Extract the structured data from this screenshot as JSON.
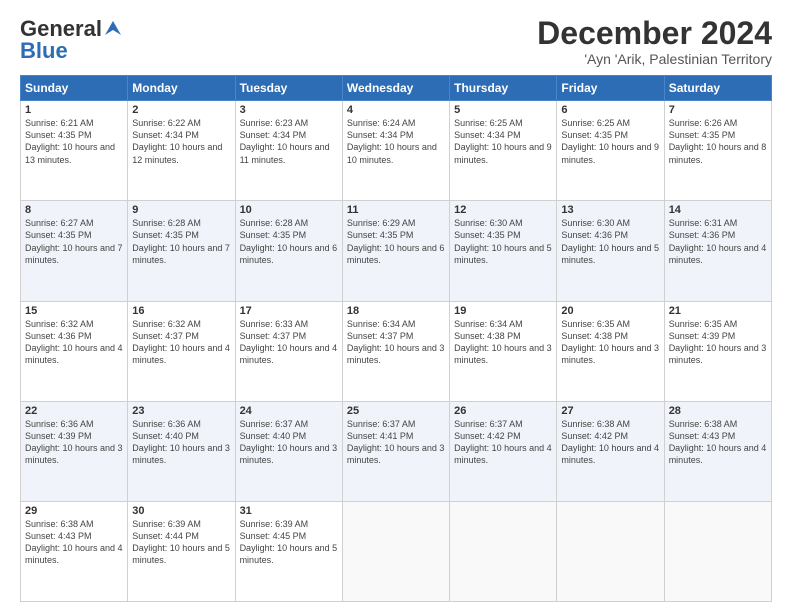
{
  "logo": {
    "general": "General",
    "blue": "Blue"
  },
  "header": {
    "month": "December 2024",
    "location": "'Ayn 'Arik, Palestinian Territory"
  },
  "days": [
    "Sunday",
    "Monday",
    "Tuesday",
    "Wednesday",
    "Thursday",
    "Friday",
    "Saturday"
  ],
  "cells": [
    [
      {
        "num": "1",
        "rise": "Sunrise: 6:21 AM",
        "set": "Sunset: 4:35 PM",
        "day": "Daylight: 10 hours and 13 minutes."
      },
      {
        "num": "2",
        "rise": "Sunrise: 6:22 AM",
        "set": "Sunset: 4:34 PM",
        "day": "Daylight: 10 hours and 12 minutes."
      },
      {
        "num": "3",
        "rise": "Sunrise: 6:23 AM",
        "set": "Sunset: 4:34 PM",
        "day": "Daylight: 10 hours and 11 minutes."
      },
      {
        "num": "4",
        "rise": "Sunrise: 6:24 AM",
        "set": "Sunset: 4:34 PM",
        "day": "Daylight: 10 hours and 10 minutes."
      },
      {
        "num": "5",
        "rise": "Sunrise: 6:25 AM",
        "set": "Sunset: 4:34 PM",
        "day": "Daylight: 10 hours and 9 minutes."
      },
      {
        "num": "6",
        "rise": "Sunrise: 6:25 AM",
        "set": "Sunset: 4:35 PM",
        "day": "Daylight: 10 hours and 9 minutes."
      },
      {
        "num": "7",
        "rise": "Sunrise: 6:26 AM",
        "set": "Sunset: 4:35 PM",
        "day": "Daylight: 10 hours and 8 minutes."
      }
    ],
    [
      {
        "num": "8",
        "rise": "Sunrise: 6:27 AM",
        "set": "Sunset: 4:35 PM",
        "day": "Daylight: 10 hours and 7 minutes."
      },
      {
        "num": "9",
        "rise": "Sunrise: 6:28 AM",
        "set": "Sunset: 4:35 PM",
        "day": "Daylight: 10 hours and 7 minutes."
      },
      {
        "num": "10",
        "rise": "Sunrise: 6:28 AM",
        "set": "Sunset: 4:35 PM",
        "day": "Daylight: 10 hours and 6 minutes."
      },
      {
        "num": "11",
        "rise": "Sunrise: 6:29 AM",
        "set": "Sunset: 4:35 PM",
        "day": "Daylight: 10 hours and 6 minutes."
      },
      {
        "num": "12",
        "rise": "Sunrise: 6:30 AM",
        "set": "Sunset: 4:35 PM",
        "day": "Daylight: 10 hours and 5 minutes."
      },
      {
        "num": "13",
        "rise": "Sunrise: 6:30 AM",
        "set": "Sunset: 4:36 PM",
        "day": "Daylight: 10 hours and 5 minutes."
      },
      {
        "num": "14",
        "rise": "Sunrise: 6:31 AM",
        "set": "Sunset: 4:36 PM",
        "day": "Daylight: 10 hours and 4 minutes."
      }
    ],
    [
      {
        "num": "15",
        "rise": "Sunrise: 6:32 AM",
        "set": "Sunset: 4:36 PM",
        "day": "Daylight: 10 hours and 4 minutes."
      },
      {
        "num": "16",
        "rise": "Sunrise: 6:32 AM",
        "set": "Sunset: 4:37 PM",
        "day": "Daylight: 10 hours and 4 minutes."
      },
      {
        "num": "17",
        "rise": "Sunrise: 6:33 AM",
        "set": "Sunset: 4:37 PM",
        "day": "Daylight: 10 hours and 4 minutes."
      },
      {
        "num": "18",
        "rise": "Sunrise: 6:34 AM",
        "set": "Sunset: 4:37 PM",
        "day": "Daylight: 10 hours and 3 minutes."
      },
      {
        "num": "19",
        "rise": "Sunrise: 6:34 AM",
        "set": "Sunset: 4:38 PM",
        "day": "Daylight: 10 hours and 3 minutes."
      },
      {
        "num": "20",
        "rise": "Sunrise: 6:35 AM",
        "set": "Sunset: 4:38 PM",
        "day": "Daylight: 10 hours and 3 minutes."
      },
      {
        "num": "21",
        "rise": "Sunrise: 6:35 AM",
        "set": "Sunset: 4:39 PM",
        "day": "Daylight: 10 hours and 3 minutes."
      }
    ],
    [
      {
        "num": "22",
        "rise": "Sunrise: 6:36 AM",
        "set": "Sunset: 4:39 PM",
        "day": "Daylight: 10 hours and 3 minutes."
      },
      {
        "num": "23",
        "rise": "Sunrise: 6:36 AM",
        "set": "Sunset: 4:40 PM",
        "day": "Daylight: 10 hours and 3 minutes."
      },
      {
        "num": "24",
        "rise": "Sunrise: 6:37 AM",
        "set": "Sunset: 4:40 PM",
        "day": "Daylight: 10 hours and 3 minutes."
      },
      {
        "num": "25",
        "rise": "Sunrise: 6:37 AM",
        "set": "Sunset: 4:41 PM",
        "day": "Daylight: 10 hours and 3 minutes."
      },
      {
        "num": "26",
        "rise": "Sunrise: 6:37 AM",
        "set": "Sunset: 4:42 PM",
        "day": "Daylight: 10 hours and 4 minutes."
      },
      {
        "num": "27",
        "rise": "Sunrise: 6:38 AM",
        "set": "Sunset: 4:42 PM",
        "day": "Daylight: 10 hours and 4 minutes."
      },
      {
        "num": "28",
        "rise": "Sunrise: 6:38 AM",
        "set": "Sunset: 4:43 PM",
        "day": "Daylight: 10 hours and 4 minutes."
      }
    ],
    [
      {
        "num": "29",
        "rise": "Sunrise: 6:38 AM",
        "set": "Sunset: 4:43 PM",
        "day": "Daylight: 10 hours and 4 minutes."
      },
      {
        "num": "30",
        "rise": "Sunrise: 6:39 AM",
        "set": "Sunset: 4:44 PM",
        "day": "Daylight: 10 hours and 5 minutes."
      },
      {
        "num": "31",
        "rise": "Sunrise: 6:39 AM",
        "set": "Sunset: 4:45 PM",
        "day": "Daylight: 10 hours and 5 minutes."
      },
      null,
      null,
      null,
      null
    ]
  ]
}
